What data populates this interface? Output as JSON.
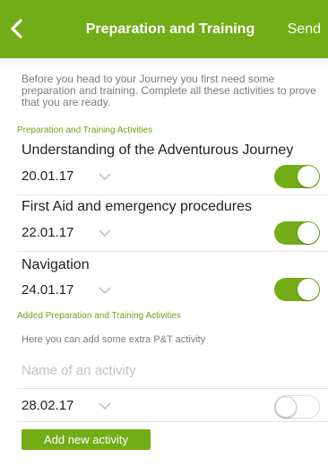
{
  "navbar": {
    "title": "Preparation and Training",
    "send_label": "Send"
  },
  "intro": "Before you head to your Journey you first need some preparation and training. Complete all these activities to prove that you are ready.",
  "activities_section": {
    "heading": "Preparation and Training Activities",
    "items": [
      {
        "title": "Understanding of the Adventurous Journey",
        "date": "20.01.17",
        "completed": true
      },
      {
        "title": "First Aid and emergency procedures",
        "date": "22.01.17",
        "completed": true
      },
      {
        "title": "Navigation",
        "date": "24.01.17",
        "completed": true
      }
    ]
  },
  "added_section": {
    "heading": "Added Preparation and Training Activities",
    "helper": "Here you can add some extra P&T activity",
    "name_placeholder": "Name of an activity",
    "name_value": "",
    "date": "28.02.17",
    "completed": false,
    "add_button_label": "Add new activity"
  },
  "colors": {
    "accent": "#72ad17",
    "section_heading": "#6aa61a",
    "muted_text": "#7b7b7b"
  },
  "icons": {
    "back": "chevron-left-icon",
    "date_picker": "chevron-down-icon"
  }
}
